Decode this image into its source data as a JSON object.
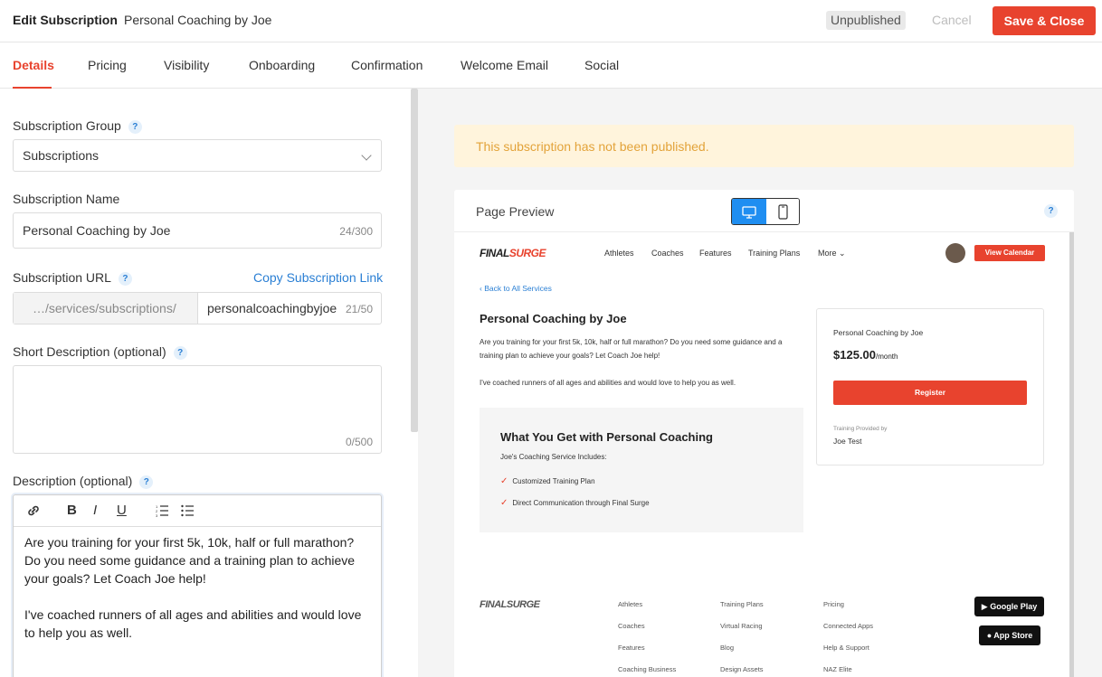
{
  "header": {
    "title": "Edit Subscription",
    "subtitle": "Personal Coaching by Joe",
    "status": "Unpublished",
    "cancel_label": "Cancel",
    "save_label": "Save & Close"
  },
  "tabs": [
    {
      "label": "Details"
    },
    {
      "label": "Pricing"
    },
    {
      "label": "Visibility"
    },
    {
      "label": "Onboarding"
    },
    {
      "label": "Confirmation"
    },
    {
      "label": "Welcome Email"
    },
    {
      "label": "Social"
    }
  ],
  "form": {
    "group_label": "Subscription Group",
    "group_value": "Subscriptions",
    "name_label": "Subscription Name",
    "name_value": "Personal Coaching by Joe",
    "name_count": "24/300",
    "url_label": "Subscription URL",
    "copy_link": "Copy Subscription Link",
    "url_prefix": "…/services/subscriptions/",
    "url_value": "personalcoachingbyjoe",
    "url_count": "21/50",
    "short_label": "Short Description (optional)",
    "short_count": "0/500",
    "desc_label": "Description (optional)",
    "desc_p1": "Are you training for your first 5k, 10k, half or full marathon? Do you need some guidance and a training plan to achieve your goals?  Let Coach Joe help!",
    "desc_p2": "I've coached runners of all ages and abilities and would love to help you as well.",
    "help": "?"
  },
  "editor_toolbar": {
    "bold": "B",
    "italic": "I",
    "underline": "U"
  },
  "alert": "This subscription has not been published.",
  "preview": {
    "title": "Page Preview",
    "help": "?",
    "site": {
      "logo": "FINALSURGE",
      "logo_a": "FINAL",
      "logo_b": "SURGE",
      "nav": [
        "Athletes",
        "Coaches",
        "Features",
        "Training Plans",
        "More"
      ],
      "view_calendar": "View Calendar",
      "back": "Back to All Services",
      "title": "Personal Coaching by Joe",
      "desc1": "Are you training for your first 5k, 10k, half or full marathon? Do you need some guidance and a training plan to achieve your goals? Let Coach Joe help!",
      "desc2": "I've coached runners of all ages and abilities and would love to help you as well.",
      "card_name": "Personal Coaching by Joe",
      "price": "$125.00",
      "period": "/month",
      "register": "Register",
      "provided_by": "Training Provided by",
      "provider": "Joe Test",
      "box_title": "What You Get with Personal Coaching",
      "box_sub": "Joe's Coaching Service Includes:",
      "box_items": [
        "Customized Training Plan",
        "Direct Communication through Final Surge"
      ],
      "footer_col1": [
        "Athletes",
        "Coaches",
        "Features",
        "Coaching Business"
      ],
      "footer_col2": [
        "Training Plans",
        "Virtual Racing",
        "Blog",
        "Design Assets"
      ],
      "footer_col3": [
        "Pricing",
        "Connected Apps",
        "Help & Support",
        "NAZ Elite"
      ],
      "google_play": "Google Play",
      "app_store": "App Store"
    }
  }
}
